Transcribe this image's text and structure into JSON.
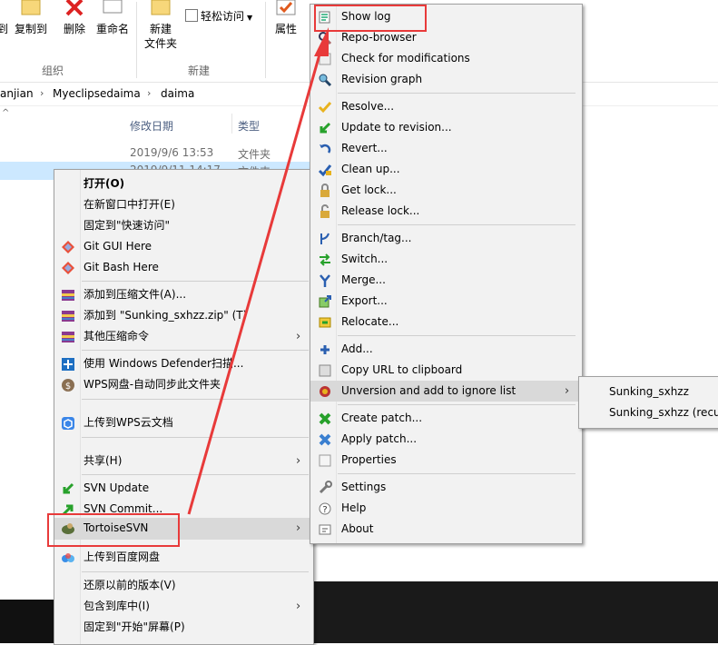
{
  "ribbon": {
    "buttons": {
      "copy_left": "到",
      "copy_to": "复制到",
      "delete": "删除",
      "rename": "重命名",
      "new_folder_line1": "新建",
      "new_folder_line2": "文件夹",
      "easy_access": "轻松访问",
      "properties": "属性"
    },
    "groups": {
      "organize": "组织",
      "new": "新建"
    }
  },
  "address_bar": {
    "crumbs": [
      "anjian",
      "Myeclipsedaima",
      "daima"
    ]
  },
  "file_list": {
    "col_date": "修改日期",
    "col_type": "类型",
    "rows": [
      {
        "date": "2019/9/6 13:53",
        "type": "文件夹"
      },
      {
        "date": "2019/9/11 14:17",
        "type": "文件夹"
      }
    ]
  },
  "explorer_menu": {
    "items": [
      {
        "label": "打开(O)",
        "icon": "none"
      },
      {
        "label": "在新窗口中打开(E)",
        "icon": "none"
      },
      {
        "label": "固定到\"快速访问\"",
        "icon": "none"
      },
      {
        "label": "Git GUI Here",
        "icon": "git-gui-icon"
      },
      {
        "label": "Git Bash Here",
        "icon": "git-bash-icon"
      },
      {
        "label": "添加到压缩文件(A)...",
        "icon": "winrar-icon"
      },
      {
        "label": "添加到 \"Sunking_sxhzz.zip\" (T)",
        "icon": "winrar-icon"
      },
      {
        "label": "其他压缩命令",
        "icon": "winrar-icon"
      },
      {
        "label": "使用 Windows Defender扫描...",
        "icon": "defender-icon"
      },
      {
        "label": "WPS网盘-自动同步此文件夹",
        "icon": "wps-drive-icon"
      },
      {
        "label": "上传到WPS云文档",
        "icon": "wps-cloud-icon"
      },
      {
        "label": "共享(H)",
        "icon": "none"
      },
      {
        "label": "SVN Update",
        "icon": "svn-update-icon"
      },
      {
        "label": "SVN Commit...",
        "icon": "svn-commit-icon"
      },
      {
        "label": "TortoiseSVN",
        "icon": "tortoise-icon"
      },
      {
        "label": "上传到百度网盘",
        "icon": "baidu-icon"
      },
      {
        "label": "还原以前的版本(V)",
        "icon": "none"
      },
      {
        "label": "包含到库中(I)",
        "icon": "none"
      },
      {
        "label": "固定到\"开始\"屏幕(P)",
        "icon": "none"
      }
    ]
  },
  "svn_menu": {
    "items": [
      {
        "label": "Show log",
        "icon": "show-log-icon"
      },
      {
        "label": "Repo-browser",
        "icon": "repo-browser-icon"
      },
      {
        "label": "Check for modifications",
        "icon": "check-mod-icon"
      },
      {
        "label": "Revision graph",
        "icon": "revision-graph-icon"
      },
      {
        "label": "Resolve...",
        "icon": "resolve-icon"
      },
      {
        "label": "Update to revision...",
        "icon": "update-rev-icon"
      },
      {
        "label": "Revert...",
        "icon": "revert-icon"
      },
      {
        "label": "Clean up...",
        "icon": "cleanup-icon"
      },
      {
        "label": "Get lock...",
        "icon": "lock-icon"
      },
      {
        "label": "Release lock...",
        "icon": "unlock-icon"
      },
      {
        "label": "Branch/tag...",
        "icon": "branch-icon"
      },
      {
        "label": "Switch...",
        "icon": "switch-icon"
      },
      {
        "label": "Merge...",
        "icon": "merge-icon"
      },
      {
        "label": "Export...",
        "icon": "export-icon"
      },
      {
        "label": "Relocate...",
        "icon": "relocate-icon"
      },
      {
        "label": "Add...",
        "icon": "add-icon"
      },
      {
        "label": "Copy URL to clipboard",
        "icon": "copy-url-icon"
      },
      {
        "label": "Unversion and add to ignore list",
        "icon": "ignore-icon"
      },
      {
        "label": "Create patch...",
        "icon": "create-patch-icon"
      },
      {
        "label": "Apply patch...",
        "icon": "apply-patch-icon"
      },
      {
        "label": "Properties",
        "icon": "properties-icon"
      },
      {
        "label": "Settings",
        "icon": "settings-icon"
      },
      {
        "label": "Help",
        "icon": "help-icon"
      },
      {
        "label": "About",
        "icon": "about-icon"
      }
    ]
  },
  "ignore_submenu": {
    "items": [
      {
        "label": "Sunking_sxhzz"
      },
      {
        "label": "Sunking_sxhzz (recur"
      }
    ]
  },
  "colors": {
    "annotation_red": "#e83a3a",
    "menu_bg": "#f2f2f2",
    "highlight": "#d9d9d9"
  }
}
